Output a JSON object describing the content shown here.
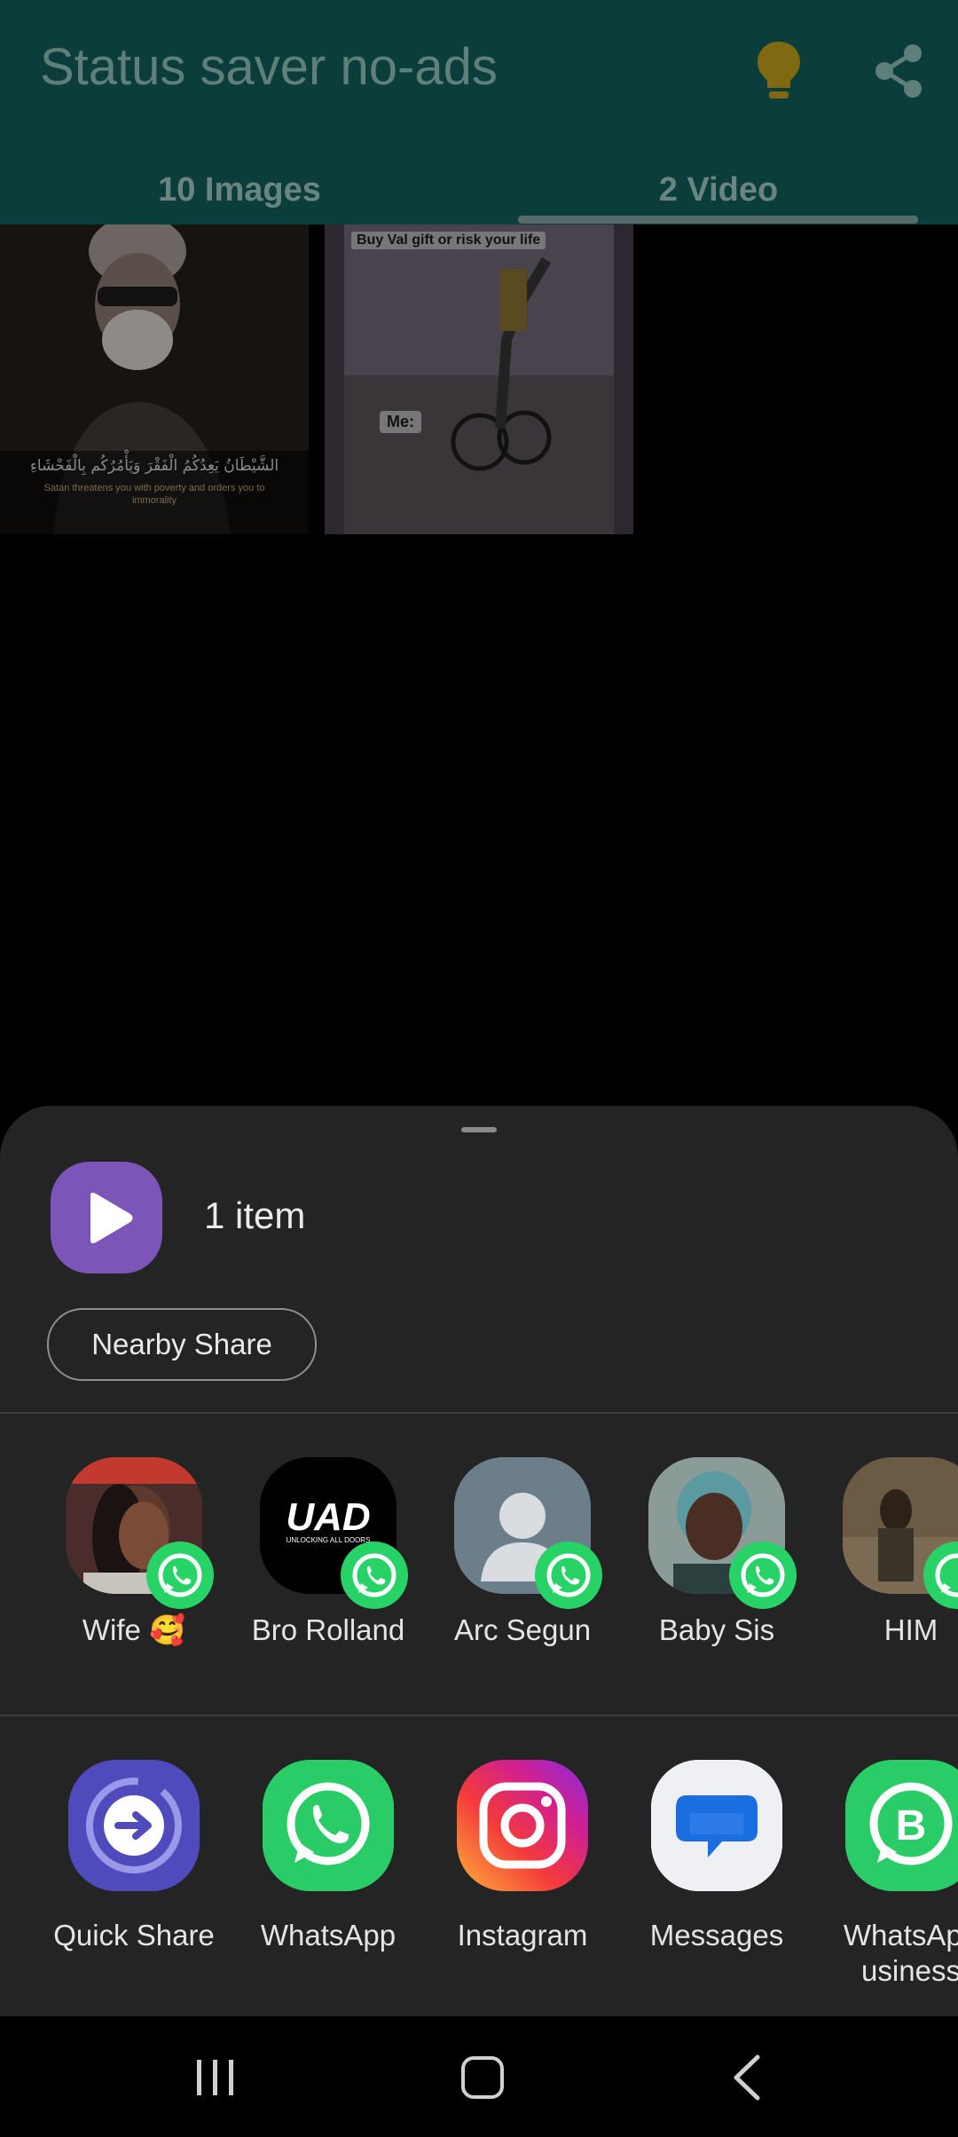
{
  "app": {
    "title": "Status saver no-ads",
    "tabs": [
      {
        "label": "10 Images"
      },
      {
        "label": "2 Video"
      }
    ],
    "thumbnails": [
      {
        "caption_ar": "الشَّيْطَانُ يَعِدُكُمُ الْفَقْرَ وَيَأْمُرُكُم بِالْفَحْشَاءِ",
        "caption": "Satan threatens you with poverty and orders you to immorality"
      },
      {
        "caption_top": "Buy Val gift or risk your life",
        "caption_mid": "Me:"
      }
    ]
  },
  "share_sheet": {
    "item_count": "1 item",
    "nearby_share": "Nearby Share",
    "contacts": [
      {
        "name": "Wife 🥰"
      },
      {
        "name": "Bro Rolland"
      },
      {
        "name": "Arc Segun"
      },
      {
        "name": "Baby Sis"
      },
      {
        "name": "HIM"
      }
    ],
    "apps": [
      {
        "name": "Quick Share"
      },
      {
        "name": "WhatsApp"
      },
      {
        "name": "Instagram"
      },
      {
        "name": "Messages"
      },
      {
        "name": "WhatsApp\nusiness"
      }
    ],
    "colors": {
      "sheet_bg": "#242424",
      "accent_whatsapp": "#27d367",
      "app_bar": "#0b3e3a"
    }
  },
  "icons": [
    "lightbulb-icon",
    "share-icon",
    "play-icon",
    "whatsapp-icon",
    "quick-share-icon",
    "instagram-icon",
    "messages-icon",
    "whatsapp-business-icon",
    "recents-icon",
    "home-icon",
    "back-icon"
  ]
}
